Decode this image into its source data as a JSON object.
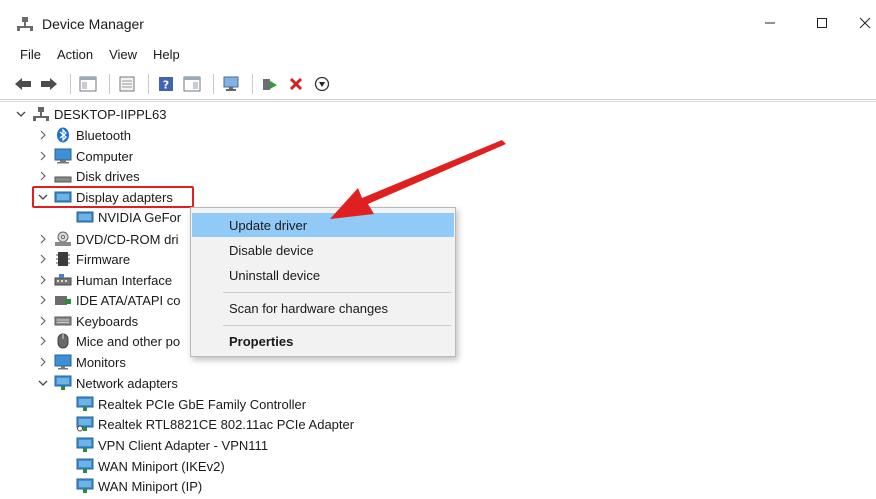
{
  "window": {
    "title": "Device Manager",
    "controls": {
      "minimize": "—",
      "maximize": "☐",
      "close": "✕"
    }
  },
  "menu": [
    "File",
    "Action",
    "View",
    "Help"
  ],
  "toolbar": {
    "buttons": [
      "back-arrow-icon",
      "forward-arrow-icon",
      "properties-pane-icon",
      "device-list-icon",
      "help-icon",
      "view-pane-icon",
      "monitor-scan-icon",
      "enable-device-icon",
      "uninstall-x-icon",
      "update-driver-down-icon"
    ]
  },
  "tree": {
    "root": "DESKTOP-IIPPL63",
    "categories": [
      {
        "label": "Bluetooth",
        "expanded": false,
        "icon": "bluetooth-icon"
      },
      {
        "label": "Computer",
        "expanded": false,
        "icon": "computer-icon"
      },
      {
        "label": "Disk drives",
        "expanded": false,
        "icon": "disk-drive-icon"
      },
      {
        "label": "Display adapters",
        "expanded": true,
        "icon": "display-adapter-icon"
      },
      {
        "label": "NVIDIA GeFor",
        "child": true,
        "icon": "display-adapter-icon"
      },
      {
        "label": "DVD/CD-ROM dri",
        "expanded": false,
        "icon": "dvd-icon"
      },
      {
        "label": "Firmware",
        "expanded": false,
        "icon": "firmware-icon"
      },
      {
        "label": "Human Interface",
        "expanded": false,
        "icon": "hid-icon"
      },
      {
        "label": "IDE ATA/ATAPI co",
        "expanded": false,
        "icon": "ide-icon"
      },
      {
        "label": "Keyboards",
        "expanded": false,
        "icon": "keyboard-icon"
      },
      {
        "label": "Mice and other po",
        "expanded": false,
        "icon": "mouse-icon"
      },
      {
        "label": "Monitors",
        "expanded": false,
        "icon": "monitor-icon"
      },
      {
        "label": "Network adapters",
        "expanded": true,
        "icon": "network-icon"
      },
      {
        "label": "Realtek PCIe GbE Family Controller",
        "child": true,
        "icon": "network-icon"
      },
      {
        "label": "Realtek RTL8821CE 802.11ac PCIe Adapter",
        "child": true,
        "icon": "network-icon"
      },
      {
        "label": "VPN Client Adapter - VPN111",
        "child": true,
        "icon": "network-icon"
      },
      {
        "label": "WAN Miniport (IKEv2)",
        "child": true,
        "icon": "network-icon"
      },
      {
        "label": "WAN Miniport (IP)",
        "child": true,
        "icon": "network-icon"
      }
    ]
  },
  "context_menu": {
    "items": [
      {
        "label": "Update driver",
        "highlighted": true
      },
      {
        "label": "Disable device"
      },
      {
        "label": "Uninstall device"
      },
      {
        "label": "Scan for hardware changes"
      },
      {
        "label": "Properties",
        "bold": true
      }
    ]
  },
  "colors": {
    "highlight": "#91c9f7",
    "annotation_red": "#e02020",
    "folder_blue": "#3d8fd6"
  }
}
